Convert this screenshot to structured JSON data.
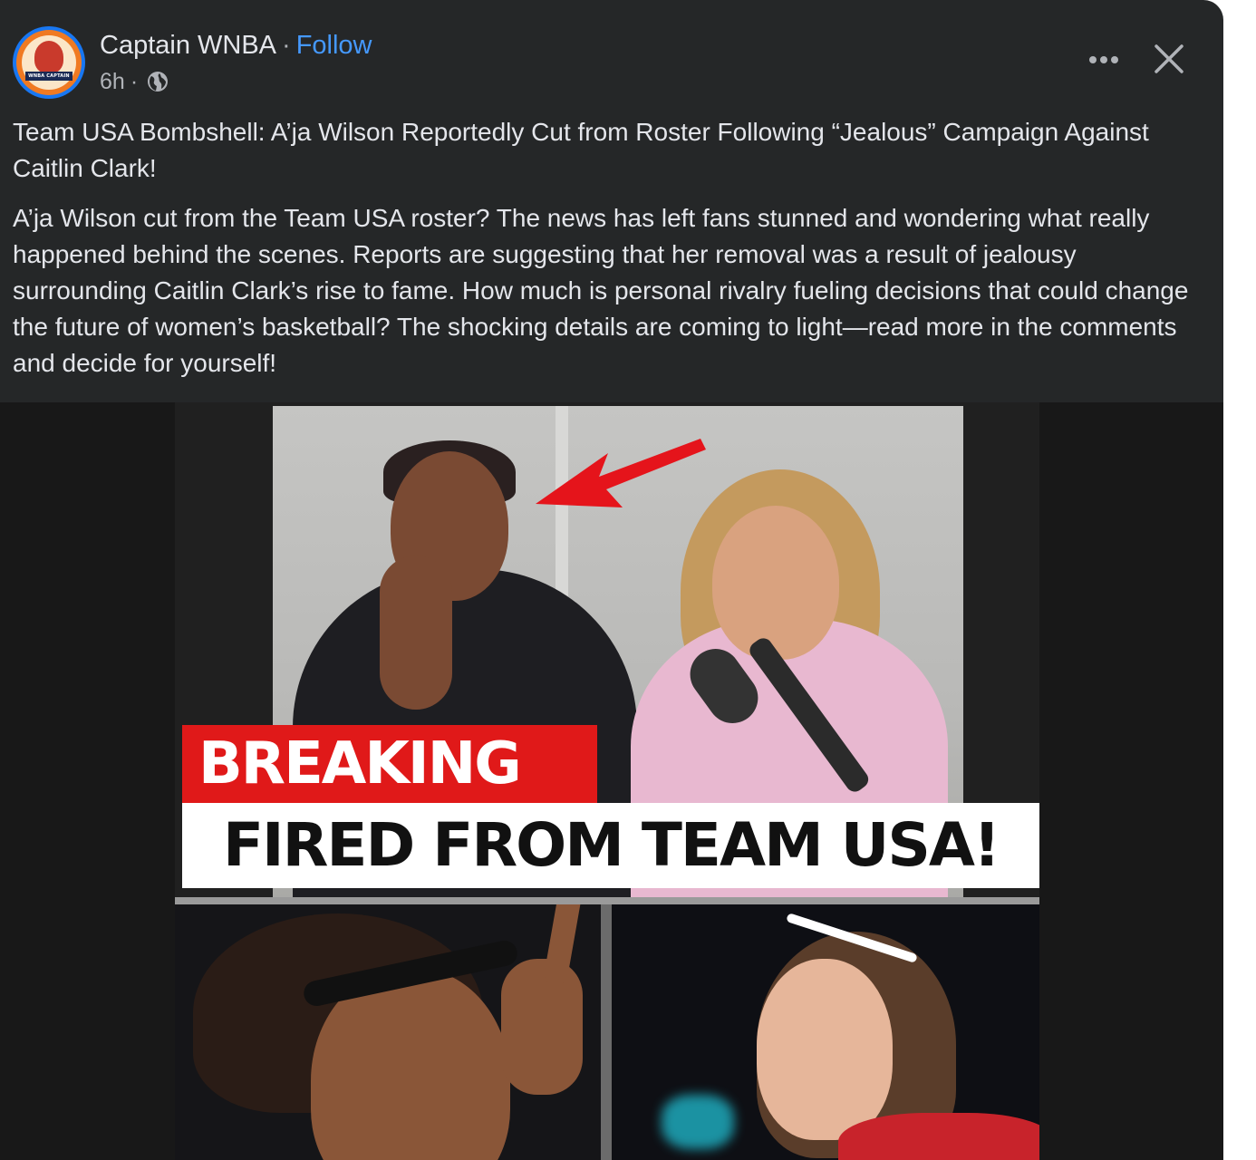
{
  "post": {
    "author": "Captain WNBA",
    "separator": "·",
    "follow_label": "Follow",
    "time": "6h",
    "meta_separator": "·",
    "audience_icon": "globe-icon",
    "avatar_text": "WNBA CAPTAIN",
    "more_icon": "more-icon",
    "close_icon": "close-icon",
    "headline": "Team USA Bombshell: A’ja Wilson Reportedly Cut from Roster Following “Jealous” Campaign Against Caitlin Clark!",
    "body": "A’ja Wilson cut from the Team USA roster? The news has left fans stunned and wondering what really happened behind the scenes. Reports are suggesting that her removal was a result of jealousy surrounding Caitlin Clark’s rise to fame. How much is personal rivalry fueling decisions that could change the future of women’s basketball? The shocking details are coming to light—read more in the comments and decide for yourself!"
  },
  "thumbnail": {
    "banner_red": "BREAKING",
    "banner_white": "FIRED FROM TEAM USA!"
  },
  "colors": {
    "card_bg": "#252728",
    "link_blue": "#4599ff",
    "text_primary": "#e4e6eb",
    "text_secondary": "#b0b3b8",
    "breaking_red": "#e01919"
  }
}
